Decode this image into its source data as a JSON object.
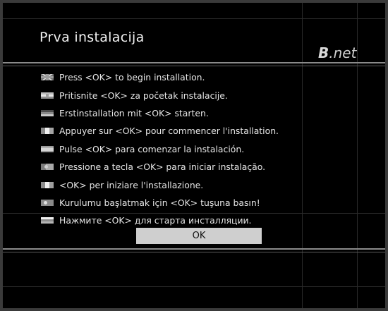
{
  "header": {
    "title": "Prva instalacija",
    "logo_brand": "B",
    "logo_suffix": ".net"
  },
  "messages": [
    {
      "flag": "uk-flag-icon",
      "text": "Press <OK> to begin installation."
    },
    {
      "flag": "croatia-flag-icon",
      "text": "Pritisnite <OK> za početak instalacije."
    },
    {
      "flag": "germany-flag-icon",
      "text": "Erstinstallation mit <OK> starten."
    },
    {
      "flag": "france-flag-icon",
      "text": "Appuyer sur <OK> pour commencer l'installation."
    },
    {
      "flag": "spain-flag-icon",
      "text": "Pulse <OK> para comenzar la instalación."
    },
    {
      "flag": "portugal-flag-icon",
      "text": "Pressione a tecla <OK> para iniciar instalação."
    },
    {
      "flag": "italy-flag-icon",
      "text": "<OK> per iniziare l'installazione."
    },
    {
      "flag": "turkey-flag-icon",
      "text": "Kurulumu başlatmak için <OK> tuşuna basın!"
    },
    {
      "flag": "russia-flag-icon",
      "text": "Нажмите <OK> для старта инсталляции."
    }
  ],
  "actions": {
    "ok_label": "OK"
  },
  "colors": {
    "background": "#000000",
    "text": "#e6e6e6",
    "button": "#cfcfcf"
  }
}
